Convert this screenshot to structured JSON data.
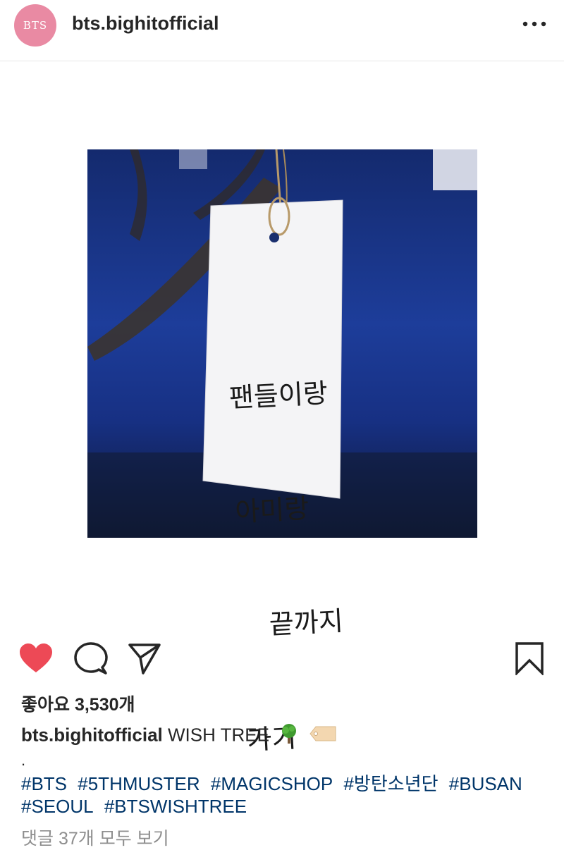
{
  "header": {
    "avatar_text": "BTS",
    "username": "bts.bighitofficial",
    "more_icon": "more-horizontal-icon"
  },
  "post": {
    "tag_lines": [
      "팬들이랑",
      "아미랑",
      "끝까지",
      "가기"
    ]
  },
  "actions": {
    "like_icon": "heart-icon",
    "comment_icon": "comment-icon",
    "share_icon": "send-icon",
    "save_icon": "bookmark-icon",
    "liked": true,
    "like_color": "#ed4956"
  },
  "likes_text": "좋아요 3,530개",
  "caption": {
    "username": "bts.bighitofficial",
    "text": "WISH TREE",
    "emojis": [
      "tree-emoji",
      "label-tag-emoji"
    ]
  },
  "dot": ".",
  "hashtags": [
    "#BTS",
    "#5THMUSTER",
    "#MAGICSHOP",
    "#방탄소년단",
    "#BUSAN",
    "#SEOUL",
    "#BTSWISHTREE"
  ],
  "comments_link": "댓글 37개 모두 보기",
  "colors": {
    "hashtag": "#003569",
    "avatar_bg": "#e98aa3",
    "muted": "#8e8e8e"
  }
}
